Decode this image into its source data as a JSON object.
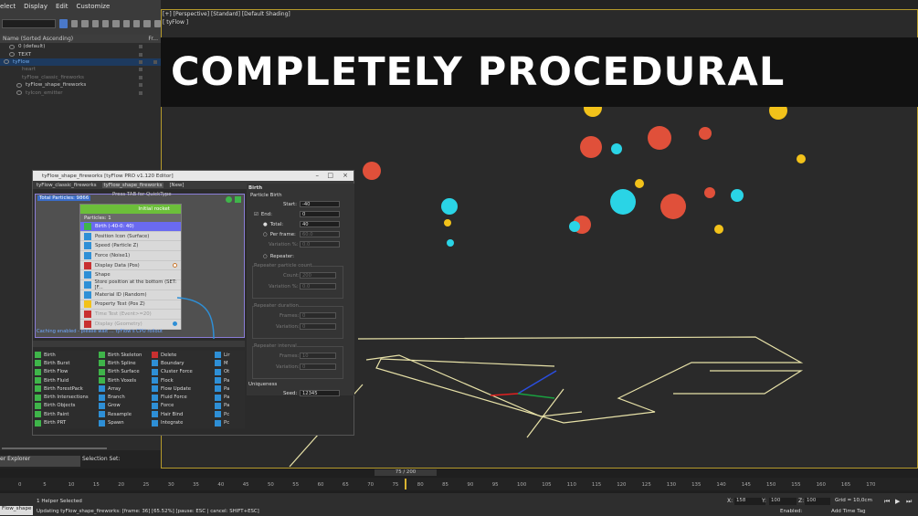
{
  "menubar": {
    "items": [
      "elect",
      "Display",
      "Edit",
      "Customize"
    ]
  },
  "explorer": {
    "header_left": "Name (Sorted Ascending)",
    "header_right": "Fr...",
    "rows": [
      "0 (default)",
      "TEXT",
      "tyFlow",
      "heart",
      "tyFlow_classic_fireworks",
      "tyFlow_shape_fireworks",
      "tyIcon_emitter"
    ],
    "footer": "er Explorer",
    "selection_sets": "Selection Set:"
  },
  "viewport": {
    "label": "[+] [Perspective] [Standard] [Default Shading]",
    "sublabel": "[ tyFlow ]"
  },
  "banner": {
    "text": "COMPLETELY PROCEDURAL"
  },
  "editor": {
    "title": "tyFlow_shape_fireworks [tyFlow PRO v1.120 Editor]",
    "tabs": [
      "tyFlow_classic_fireworks",
      "tyFlow_shape_fireworks",
      "[New]"
    ],
    "total_particles": "Total Particles: 9866",
    "quickhint": "Press TAB for QuickType",
    "caching_msg": "Caching enabled - please wait ... tyFlow's CPU rollout",
    "event": {
      "title": "Initial rocket",
      "subtitle": "Particles: 1",
      "operators": [
        "Birth (-40-0: 40)",
        "Position Icon (Surface)",
        "Speed (Particle Z)",
        "Force (Noise1)",
        "Display Data (Pos)",
        "Shape",
        "Store position at the bottom (SET: [F...",
        "Material ID (Random)",
        "Property Test (Pos Z)",
        "Time Test (Event>=20)",
        "Display (Geometry)"
      ]
    },
    "oplist": {
      "col1": [
        "Birth",
        "Birth Burst",
        "Birth Flow",
        "Birth Fluid",
        "Birth ForestPack",
        "Birth Intersections",
        "Birth Objects",
        "Birth Paint",
        "Birth PRT"
      ],
      "col2": [
        "Birth Skeleton",
        "Birth Spline",
        "Birth Surface",
        "Birth Voxels",
        "Array",
        "Branch",
        "Grow",
        "Resample",
        "Spawn"
      ],
      "col3": [
        "Delete",
        "Boundary",
        "Cluster Force",
        "Flock",
        "Flow Update",
        "Fluid Force",
        "Force",
        "Hair Bind",
        "Integrate"
      ],
      "col4": [
        "Lir",
        "M",
        "Ot",
        "Pa",
        "Pa",
        "Pa",
        "Pa",
        "Pc",
        "Pc"
      ]
    },
    "params": {
      "rollout": "Birth",
      "section": "Particle Birth",
      "start_label": "Start:",
      "start_value": "-40",
      "end_label": "End:",
      "end_value": "0",
      "total_label": "Total:",
      "total_value": "40",
      "perframe_label": "Per frame:",
      "perframe_value": "60.0",
      "variation_label": "Variation %:",
      "variation_value": "0.0",
      "repeater_label": "Repeater:",
      "rpc_label": "Repeater particle count",
      "count_label": "Count:",
      "count_value": "200",
      "var2_label": "Variation %:",
      "var2_value": "0.0",
      "rdur_label": "Repeater duration",
      "frames_label": "Frames:",
      "frames_value": "0",
      "variation3_label": "Variation:",
      "variation3_value": "0",
      "rint_label": "Repeater interval",
      "frames2_label": "Frames:",
      "frames2_value": "10",
      "variation4_label": "Variation:",
      "variation4_value": "0",
      "uniqueness_label": "Uniqueness",
      "seed_label": "Seed:",
      "seed_value": "12345"
    }
  },
  "timeline": {
    "slider": "75 / 200",
    "ticks": [
      "0",
      "5",
      "10",
      "15",
      "20",
      "25",
      "30",
      "35",
      "40",
      "45",
      "50",
      "55",
      "60",
      "65",
      "70",
      "75",
      "80",
      "85",
      "90",
      "95",
      "100",
      "105",
      "110",
      "115",
      "120",
      "125",
      "130",
      "135",
      "140",
      "145",
      "150",
      "155",
      "160",
      "165",
      "170"
    ]
  },
  "status": {
    "script": "Flow_shape",
    "selected": "1 Helper Selected",
    "progress": "Updating tyFlow_shape_fireworks: [frame: 36] [65.52%] [pause: ESC | cancel: SHIFT+ESC]",
    "x_label": "X:",
    "x_value": "158",
    "y_label": "Y:",
    "y_value": "100",
    "z_label": "Z:",
    "z_value": "100",
    "grid": "Grid = 10,0cm",
    "enabled": "Enabled:",
    "addtimetag": "Add Time Tag"
  },
  "colors": {
    "accent_green": "#6cbf3a",
    "accent_blue": "#2e8fd6",
    "hearts_red": "#c83030",
    "hearts_cyan": "#2ad4e6",
    "hearts_yellow": "#f2c21a"
  }
}
